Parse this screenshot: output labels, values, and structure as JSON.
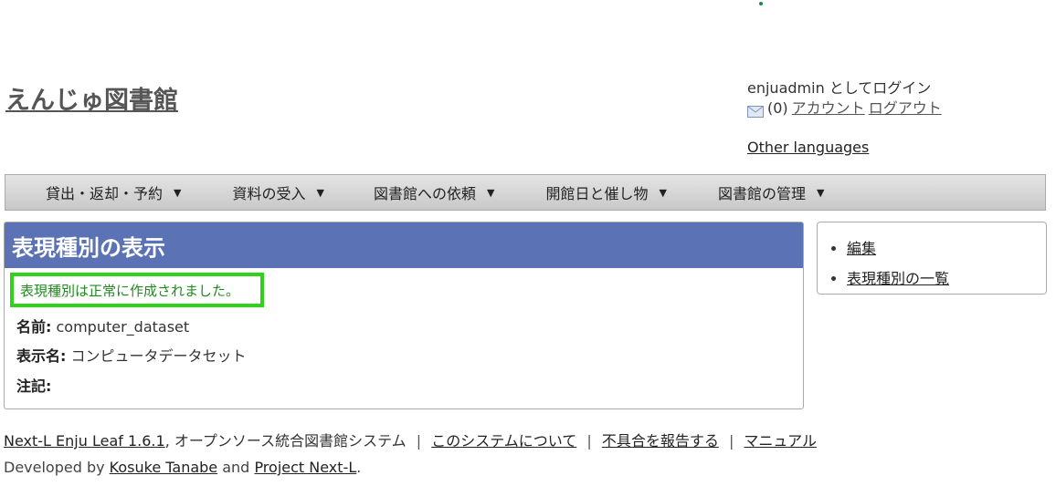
{
  "site": {
    "title": "えんじゅ図書館"
  },
  "user": {
    "login_text": "enjuadmin としてログイン",
    "message_count": "(0)",
    "account_link": "アカウント",
    "logout_link": "ログアウト",
    "other_languages": "Other languages"
  },
  "menu": {
    "items": [
      {
        "label": "貸出・返却・予約"
      },
      {
        "label": "資料の受入"
      },
      {
        "label": "図書館への依頼"
      },
      {
        "label": "開館日と催し物"
      },
      {
        "label": "図書館の管理"
      }
    ]
  },
  "content": {
    "heading": "表現種別の表示",
    "notice": "表現種別は正常に作成されました。",
    "fields": [
      {
        "label": "名前:",
        "value": "computer_dataset"
      },
      {
        "label": "表示名:",
        "value": "コンピュータデータセット"
      },
      {
        "label": "注記:",
        "value": ""
      }
    ]
  },
  "sidebar": {
    "links": [
      {
        "label": "編集"
      },
      {
        "label": "表現種別の一覧"
      }
    ]
  },
  "footer": {
    "product_link": "Next-L Enju Leaf 1.6.1",
    "product_suffix": ", オープンソース統合図書館システム",
    "sep": "|",
    "about_link": "このシステムについて",
    "report_link": "不具合を報告する",
    "manual_link": "マニュアル",
    "developed_by": "Developed by",
    "author_link": "Kosuke Tanabe",
    "and": "and",
    "project_link": "Project Next-L",
    "period": "."
  },
  "colors": {
    "header_bar": "#5b73b5",
    "notice_border": "#2fd11a",
    "notice_text": "#1f8a1f"
  }
}
